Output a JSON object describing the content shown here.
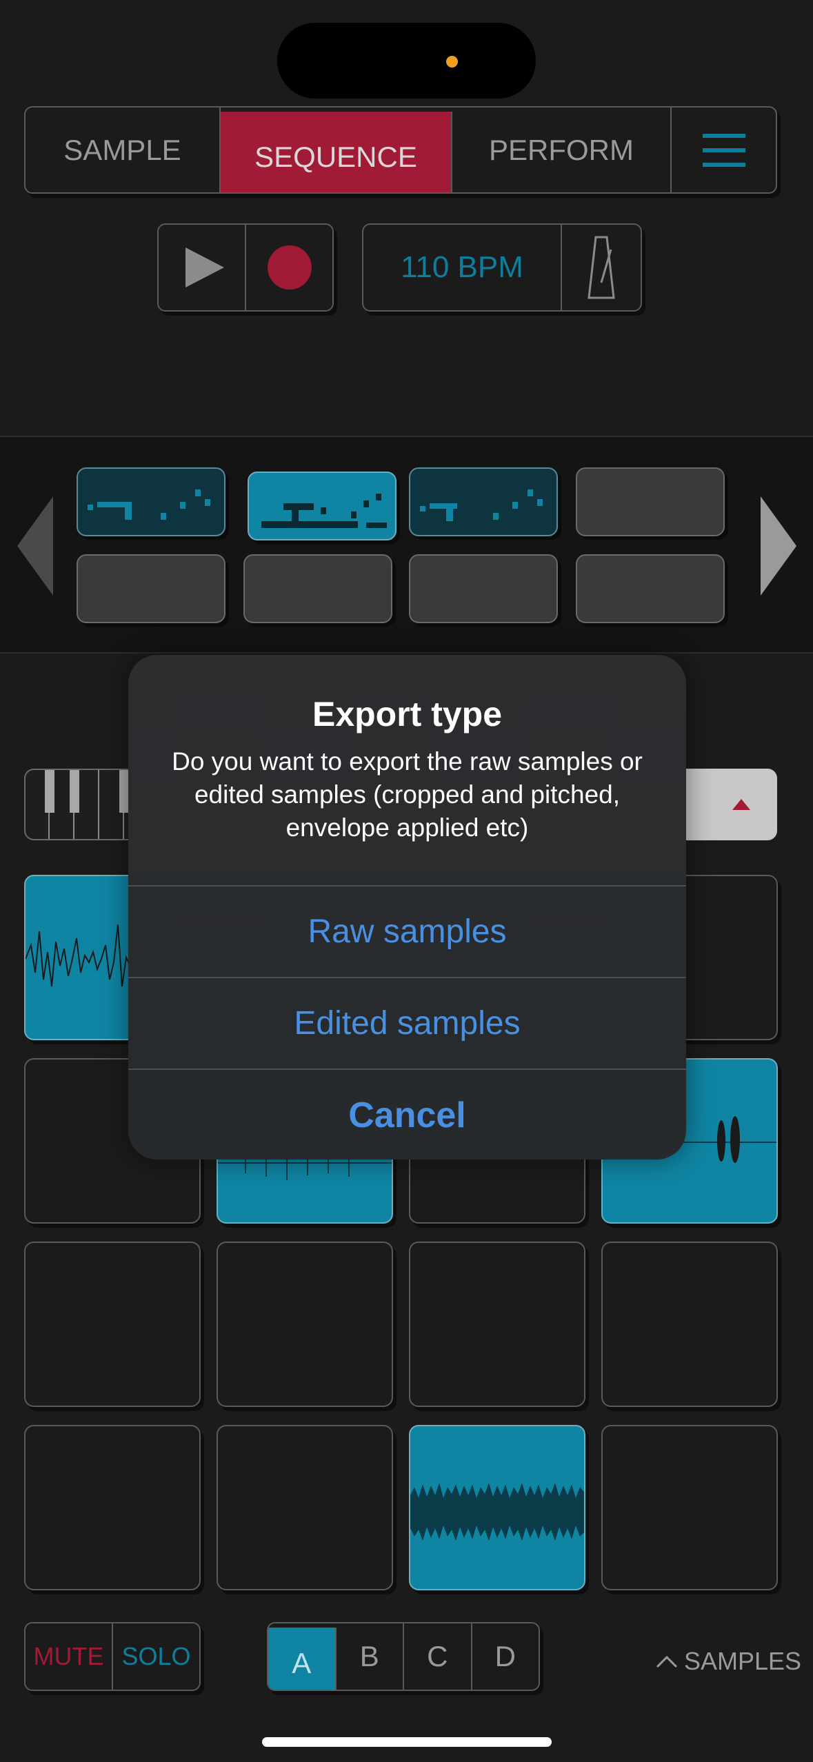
{
  "nav": {
    "tabs": [
      "SAMPLE",
      "SEQUENCE",
      "PERFORM"
    ],
    "active": "SEQUENCE",
    "menu_icon": "hamburger-menu-icon"
  },
  "transport": {
    "play_icon": "play-icon",
    "record_icon": "record-icon",
    "tempo": "110 BPM",
    "metronome_icon": "metronome-icon"
  },
  "patterns": {
    "slots": [
      "filled",
      "active",
      "filled",
      "empty",
      "empty",
      "empty",
      "empty",
      "empty"
    ]
  },
  "pads": {
    "loaded": [
      0,
      7,
      14
    ]
  },
  "bottom": {
    "mute": "MUTE",
    "solo": "SOLO",
    "banks": [
      "A",
      "B",
      "C",
      "D"
    ],
    "selected_bank": "A",
    "samples_label": "SAMPLES"
  },
  "dialog": {
    "title": "Export type",
    "message": "Do you want to export the raw samples or edited samples (cropped and pitched, envelope applied etc)",
    "raw": "Raw samples",
    "edited": "Edited samples",
    "cancel": "Cancel"
  },
  "colors": {
    "accent_red": "#a11a36",
    "accent_blue": "#0f85a3",
    "dialog_link": "#4a90e2"
  }
}
